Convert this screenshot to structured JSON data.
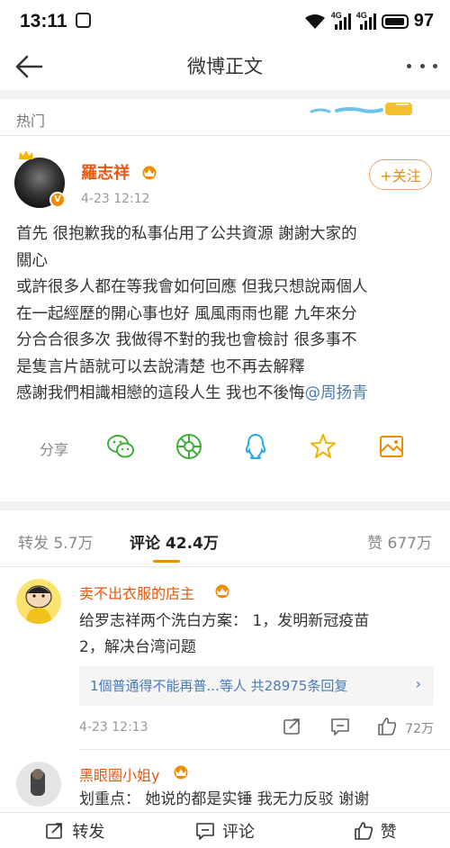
{
  "status_bar": {
    "time": "13:11",
    "battery": "97",
    "network_1": "4G",
    "network_2": "4G"
  },
  "nav": {
    "title": "微博正文"
  },
  "section_label": "热门",
  "post": {
    "author": "羅志祥",
    "time": "4-23 12:12",
    "follow_label": "+关注",
    "lines": [
      "首先 很抱歉我的私事佔用了公共資源 謝謝大家的",
      "關心",
      "或許很多人都在等我會如何回應 但我只想說兩個人",
      "在一起經歷的開心事也好 風風雨雨也罷 九年來分",
      "分合合很多次 我做得不對的我也會檢討 很多事不",
      "是隻言片語就可以去說清楚 也不再去解釋"
    ],
    "last_line": "感謝我們相識相戀的這段人生 我也不後悔",
    "mention": "@周扬青"
  },
  "share": {
    "label": "分享",
    "icons": [
      "wechat-icon",
      "moments-icon",
      "qq-icon",
      "qzone-icon",
      "save-image-icon"
    ]
  },
  "tabs": {
    "repost": "转发 5.7万",
    "comment": "评论 42.4万",
    "like": "赞 677万"
  },
  "comments": [
    {
      "name": "卖不出衣服的店主",
      "lines": [
        "给罗志祥两个洗白方案： 1，发明新冠疫苗",
        "2，解决台湾问题"
      ],
      "reply_summary": "1個普通得不能再普...等人  共28975条回复",
      "time": "4-23 12:13",
      "likes": "72万"
    },
    {
      "name": "黑眼圈小姐y",
      "lines": [
        "划重点： 她说的都是实锤 我无力反驳 谢谢"
      ]
    }
  ],
  "bottom_bar": {
    "repost": "转发",
    "comment": "评论",
    "like": "赞"
  },
  "colors": {
    "accent_orange": "#f08c00",
    "name_orange": "#e8570c",
    "link_blue": "#4a7bb7"
  }
}
